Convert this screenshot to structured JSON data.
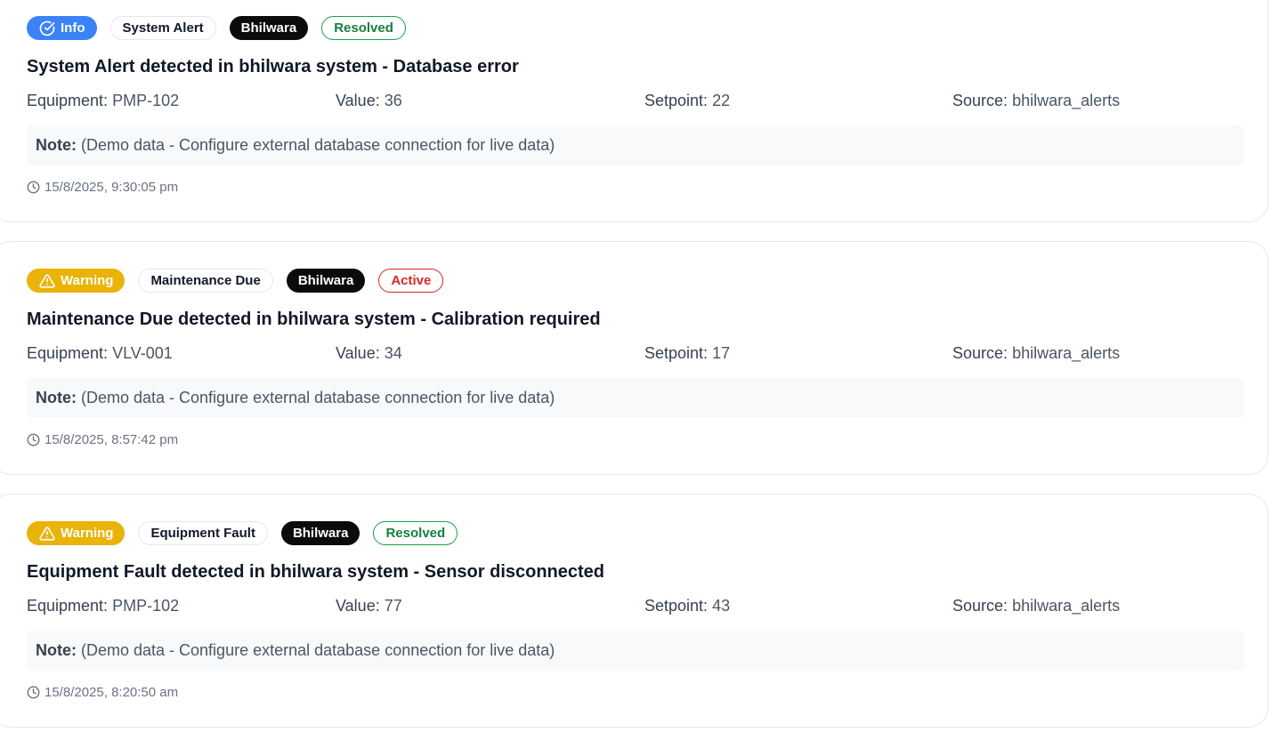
{
  "alerts": [
    {
      "severity": "Info",
      "type": "System Alert",
      "location": "Bhilwara",
      "status": "Resolved",
      "title": "System Alert detected in bhilwara system - Database error",
      "equipment_label": "Equipment:",
      "equipment": "PMP-102",
      "value_label": "Value:",
      "value": "36",
      "setpoint_label": "Setpoint:",
      "setpoint": "22",
      "source_label": "Source:",
      "source": "bhilwara_alerts",
      "note_label": "Note:",
      "note": "(Demo data - Configure external database connection for live data)",
      "timestamp": "15/8/2025, 9:30:05 pm",
      "severity_icon": "circle-check-icon"
    },
    {
      "severity": "Warning",
      "type": "Maintenance Due",
      "location": "Bhilwara",
      "status": "Active",
      "title": "Maintenance Due detected in bhilwara system - Calibration required",
      "equipment_label": "Equipment:",
      "equipment": "VLV-001",
      "value_label": "Value:",
      "value": "34",
      "setpoint_label": "Setpoint:",
      "setpoint": "17",
      "source_label": "Source:",
      "source": "bhilwara_alerts",
      "note_label": "Note:",
      "note": "(Demo data - Configure external database connection for live data)",
      "timestamp": "15/8/2025, 8:57:42 pm",
      "severity_icon": "warning-triangle-icon"
    },
    {
      "severity": "Warning",
      "type": "Equipment Fault",
      "location": "Bhilwara",
      "status": "Resolved",
      "title": "Equipment Fault detected in bhilwara system - Sensor disconnected",
      "equipment_label": "Equipment:",
      "equipment": "PMP-102",
      "value_label": "Value:",
      "value": "77",
      "setpoint_label": "Setpoint:",
      "setpoint": "43",
      "source_label": "Source:",
      "source": "bhilwara_alerts",
      "note_label": "Note:",
      "note": "(Demo data - Configure external database connection for live data)",
      "timestamp": "15/8/2025, 8:20:50 am",
      "severity_icon": "warning-triangle-icon"
    }
  ],
  "colors": {
    "info": "#3b82f6",
    "warning": "#eab308",
    "resolved": "#16a34a",
    "active": "#dc2626",
    "location_badge": "#0b0b0c",
    "note_background": "#f8f9fb"
  }
}
